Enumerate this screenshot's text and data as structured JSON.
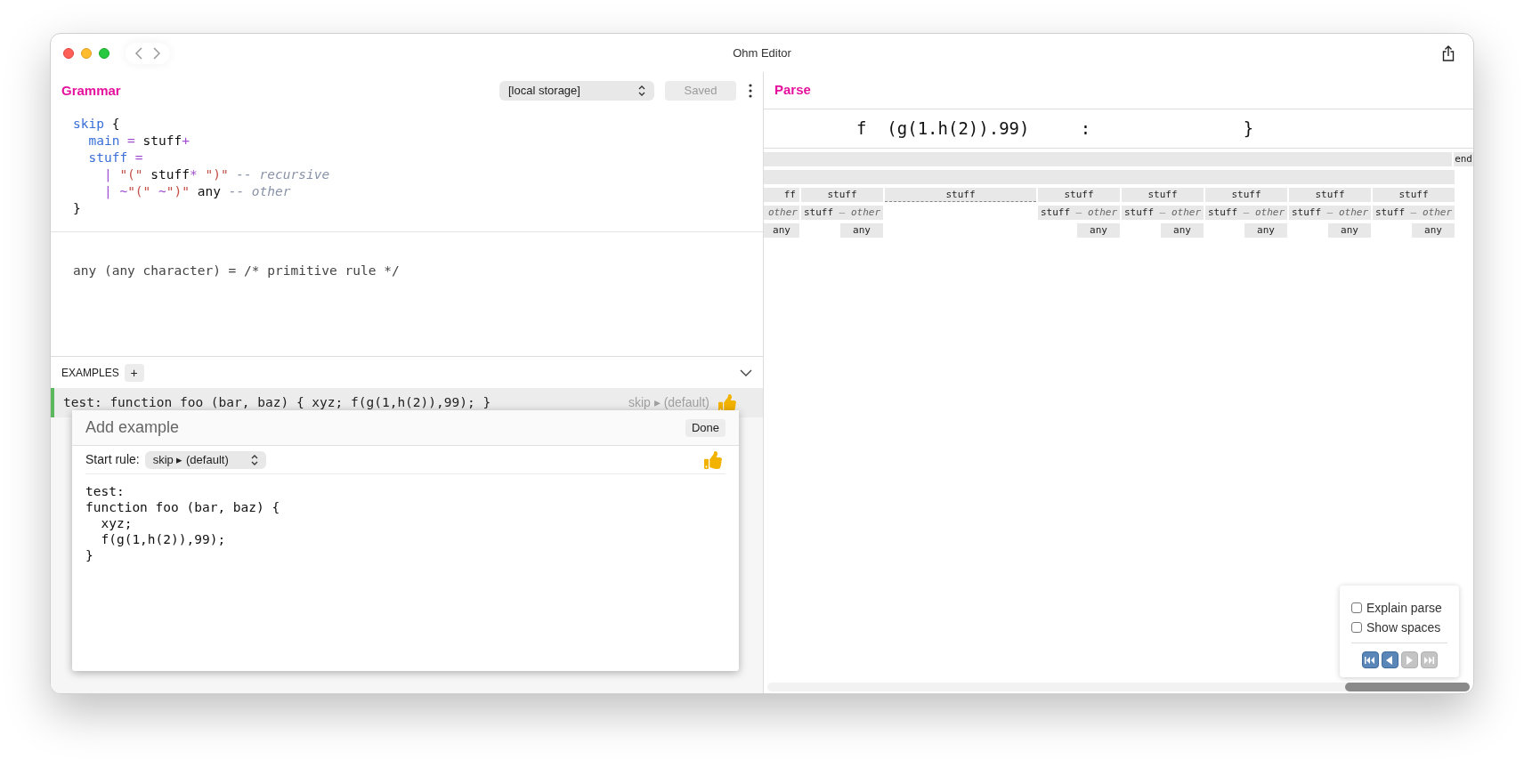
{
  "window": {
    "title": "Ohm Editor"
  },
  "grammar": {
    "title": "Grammar",
    "storage": "[local storage]",
    "save_button": {
      "label": "Saved",
      "disabled": true
    },
    "code": [
      [
        {
          "kind": "rule",
          "text": "skip"
        },
        {
          "kind": "plain",
          "text": " {"
        }
      ],
      [
        {
          "kind": "rule",
          "text": "  main"
        },
        {
          "kind": "op",
          "text": " ="
        },
        {
          "kind": "plain",
          "text": " stuff"
        },
        {
          "kind": "op",
          "text": "+"
        }
      ],
      [
        {
          "kind": "rule",
          "text": "  stuff"
        },
        {
          "kind": "op",
          "text": " ="
        }
      ],
      [
        {
          "kind": "op",
          "text": "    |"
        },
        {
          "kind": "string",
          "text": " \"(\""
        },
        {
          "kind": "plain",
          "text": " stuff"
        },
        {
          "kind": "op",
          "text": "*"
        },
        {
          "kind": "string",
          "text": " \")\""
        },
        {
          "kind": "comment",
          "text": " -- recursive"
        }
      ],
      [
        {
          "kind": "op",
          "text": "    |"
        },
        {
          "kind": "op",
          "text": " ~"
        },
        {
          "kind": "string",
          "text": "\"(\""
        },
        {
          "kind": "op",
          "text": " ~"
        },
        {
          "kind": "string",
          "text": "\")\""
        },
        {
          "kind": "plain",
          "text": " any"
        },
        {
          "kind": "comment",
          "text": " -- other"
        }
      ],
      [
        {
          "kind": "plain",
          "text": "}"
        }
      ]
    ],
    "rule_info": "any (any character) = /* primitive rule */"
  },
  "examples": {
    "title": "EXAMPLES",
    "add_label": "+",
    "items": [
      {
        "text": "test: function foo (bar, baz) { xyz; f(g(1,h(2)),99); }",
        "start_rule": "skip ▸ (default)",
        "selected": true
      }
    ],
    "editor": {
      "title": "Add example",
      "done_label": "Done",
      "start_rule_label": "Start rule:",
      "start_rule": "skip ▸ (default)",
      "lines": [
        "test:",
        "function foo (bar, baz) {",
        "  xyz;",
        "  f(g(1,h(2)),99);",
        "}"
      ]
    }
  },
  "parse": {
    "title": "Parse",
    "input": "f  (g(1.h(2)).99)     :               }",
    "end_label": "end",
    "columns": [
      {
        "kind": "matched",
        "label": "ff",
        "case_label": "other",
        "leaf": "any"
      },
      {
        "kind": "matched",
        "label": "stuff",
        "case_rule": "stuff",
        "case_label": "— other",
        "leaf": "any"
      },
      {
        "kind": "collapsed",
        "label": "stuff"
      },
      {
        "kind": "matched",
        "label": "stuff",
        "case_rule": "stuff",
        "case_label": "— other",
        "leaf": "any"
      },
      {
        "kind": "matched",
        "label": "stuff",
        "case_rule": "stuff",
        "case_label": "— other",
        "leaf": "any"
      },
      {
        "kind": "matched",
        "label": "stuff",
        "case_rule": "stuff",
        "case_label": "— other",
        "leaf": "any"
      },
      {
        "kind": "matched",
        "label": "stuff",
        "case_rule": "stuff",
        "case_label": "— other",
        "leaf": "any"
      },
      {
        "kind": "matched",
        "label": "stuff",
        "case_rule": "stuff",
        "case_label": "— other",
        "leaf": "any"
      }
    ],
    "options": [
      {
        "label": "Explain parse",
        "checked": false
      },
      {
        "label": "Show spaces",
        "checked": false
      }
    ],
    "steppers": [
      {
        "kind": "first",
        "disabled": false
      },
      {
        "kind": "back",
        "disabled": false
      },
      {
        "kind": "forward",
        "disabled": true
      },
      {
        "kind": "last",
        "disabled": true
      }
    ]
  }
}
